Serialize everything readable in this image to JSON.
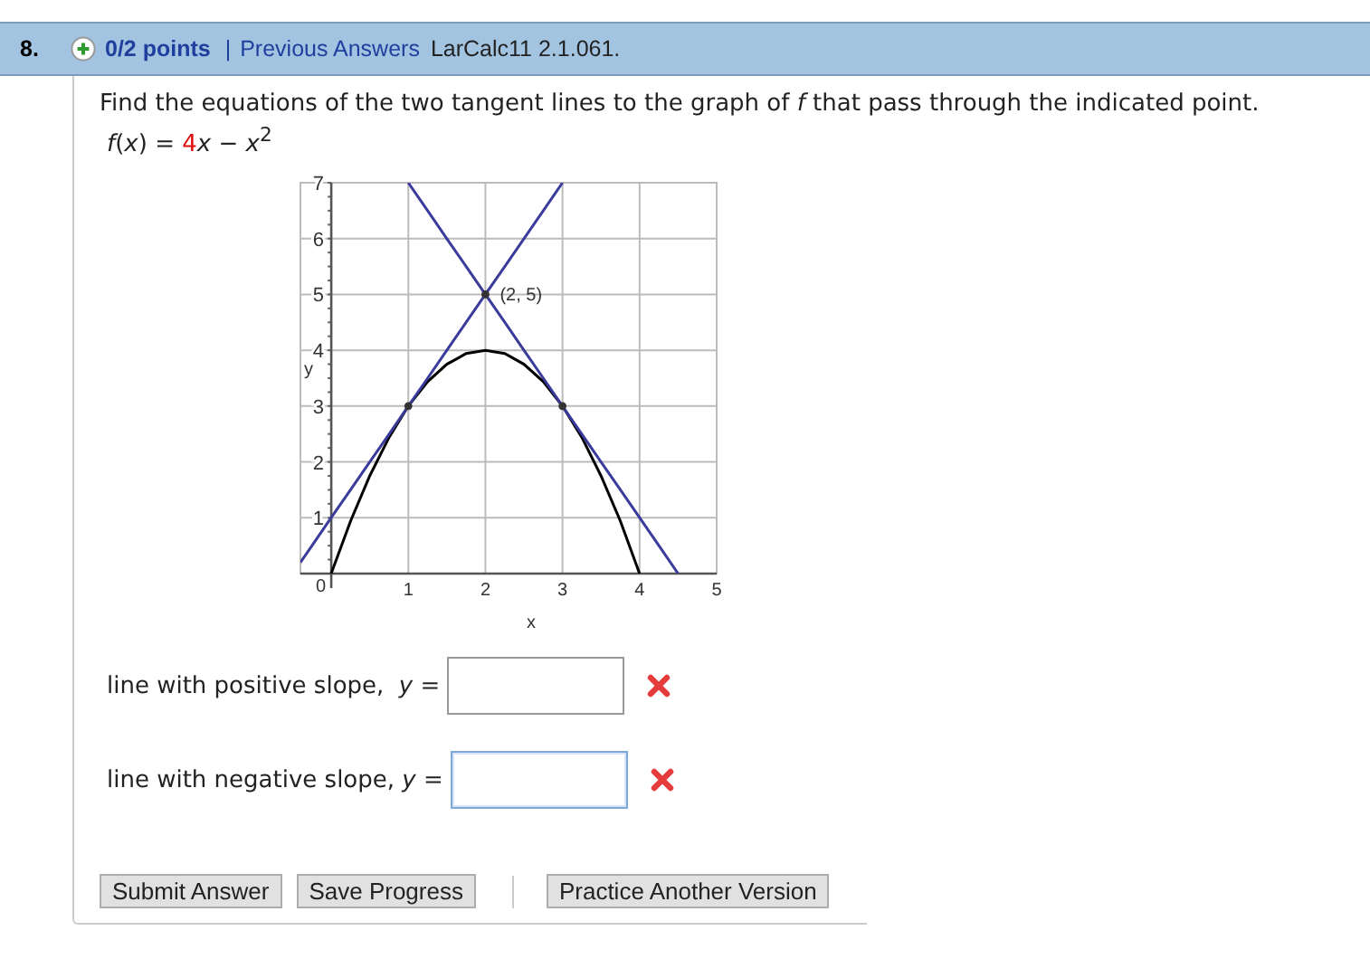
{
  "question": {
    "number": "8.",
    "points": "0/2 points",
    "separator": "|",
    "previous_answers": "Previous Answers",
    "source": "LarCalc11 2.1.061."
  },
  "prompt": "Find the equations of the two tangent lines to the graph of *f* that pass through the indicated point.",
  "function": {
    "lhs": "*f*(*x*) =",
    "coefficient": "4",
    "rhs": "*x* − *x*$^{2}$"
  },
  "graph": {
    "chart_data": {
      "type": "line",
      "xlabel": "x",
      "ylabel": "y",
      "x": [
        -0.4,
        -0.25,
        0,
        0.25,
        0.5,
        0.75,
        1,
        1.25,
        1.5,
        1.75,
        2,
        2.25,
        2.5,
        2.75,
        3,
        3.25,
        3.5,
        3.75,
        4,
        4.25,
        4.5
      ],
      "series": [
        {
          "color": "#000000",
          "values": [
            null,
            null,
            0,
            0.94,
            1.75,
            2.44,
            3,
            3.44,
            3.75,
            3.94,
            4,
            3.94,
            3.75,
            3.44,
            3,
            2.44,
            1.75,
            0.94,
            0,
            null,
            null
          ]
        },
        {
          "color": "#3b3b9c",
          "values": [
            0.2,
            0.5,
            1,
            1.5,
            2,
            2.5,
            3,
            3.5,
            4,
            4.5,
            5,
            5.5,
            6,
            6.5,
            7,
            null,
            null,
            null,
            null,
            null,
            null
          ]
        },
        {
          "color": "#3b3b9c",
          "values": [
            null,
            null,
            null,
            null,
            null,
            null,
            7,
            6.5,
            6,
            5.5,
            5,
            4.5,
            4,
            3.5,
            3,
            2.5,
            2,
            1.5,
            1,
            0.5,
            0
          ]
        }
      ],
      "xlim": [
        -0.4,
        5
      ],
      "ylim": [
        0,
        7
      ],
      "xticks": [
        0,
        1,
        2,
        3,
        4,
        5
      ],
      "yticks": [
        1,
        2,
        3,
        4,
        5,
        6,
        7
      ],
      "grid": true,
      "annotations": [
        {
          "x": 2,
          "y": 5,
          "text": "(2, 5)"
        }
      ]
    }
  },
  "answers": [
    {
      "label": "line with positive slope,  *y* =",
      "focused": false,
      "correct": false
    },
    {
      "label": "line with negative slope, *y* =",
      "focused": true,
      "correct": false
    }
  ],
  "buttons": [
    {
      "label": "Submit Answer",
      "kind": "action"
    },
    {
      "label": "Save Progress",
      "kind": "action"
    },
    {
      "label": "Practice Another Version",
      "kind": "separate"
    }
  ]
}
